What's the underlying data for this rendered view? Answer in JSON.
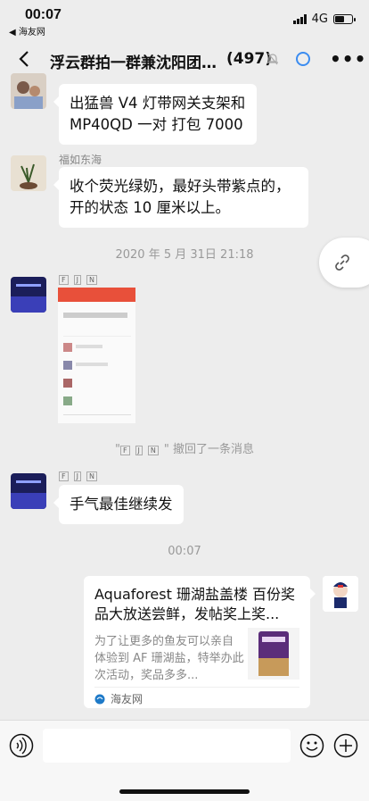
{
  "status": {
    "time": "00:07",
    "back_app": "◀ 海友网",
    "network": "4G",
    "battery_level": 0.6
  },
  "nav": {
    "title": "浮云群拍一群兼沈阳团…",
    "count": "(497)"
  },
  "messages": [
    {
      "type": "text",
      "sender": "",
      "text": "出猛兽 V4 灯带网关支架和 MP40QD 一对 打包 7000"
    },
    {
      "type": "text",
      "sender": "福如东海",
      "text": "收个荧光绿奶，最好头带紫点的，开的状态 10 厘米以上。"
    }
  ],
  "timestamp1": "2020 年 5 月 31日 21:18",
  "sender_tags": [
    "F",
    "J",
    "N"
  ],
  "recall_notice": "撤回了一条消息",
  "message3": {
    "text": "手气最佳继续发"
  },
  "timestamp2": "00:07",
  "card": {
    "title": "Aquaforest 珊湖盐盖楼 百份奖品大放送尝鲜，发帖奖上奖...",
    "desc": "为了让更多的鱼友可以亲自体验到 AF 珊湖盐，特举办此次活动，奖品多多...",
    "source": "海友网"
  }
}
